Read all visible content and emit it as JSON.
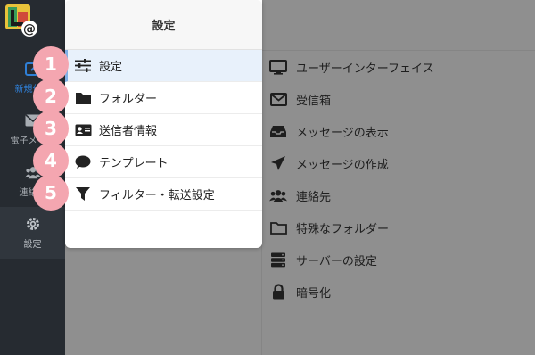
{
  "rail": {
    "items": [
      {
        "label": "新規作成",
        "icon": "compose-icon"
      },
      {
        "label": "電子メール",
        "icon": "envelope-icon"
      },
      {
        "label": "連絡先",
        "icon": "contacts-icon"
      },
      {
        "label": "設定",
        "icon": "gear-icon"
      }
    ]
  },
  "panel": {
    "title": "設定",
    "items": [
      {
        "label": "設定",
        "icon": "sliders-icon",
        "active": true
      },
      {
        "label": "フォルダー",
        "icon": "folder-icon"
      },
      {
        "label": "送信者情報",
        "icon": "id-card-icon"
      },
      {
        "label": "テンプレート",
        "icon": "speech-bubble-icon"
      },
      {
        "label": "フィルター・転送設定",
        "icon": "filter-icon"
      }
    ]
  },
  "badges": [
    "1",
    "2",
    "3",
    "4",
    "5"
  ],
  "sublist": {
    "items": [
      {
        "label": "ユーザーインターフェイス",
        "icon": "monitor-icon"
      },
      {
        "label": "受信箱",
        "icon": "envelope-icon"
      },
      {
        "label": "メッセージの表示",
        "icon": "inbox-tray-icon"
      },
      {
        "label": "メッセージの作成",
        "icon": "paper-plane-icon"
      },
      {
        "label": "連絡先",
        "icon": "users-icon"
      },
      {
        "label": "特殊なフォルダー",
        "icon": "folder-outline-icon"
      },
      {
        "label": "サーバーの設定",
        "icon": "server-icon"
      },
      {
        "label": "暗号化",
        "icon": "lock-icon"
      }
    ]
  },
  "colors": {
    "rail_bg": "#262b31",
    "overlay": "#8f8f8f",
    "badge": "#f4a6b0",
    "active_bg": "#e8f1fb",
    "accent": "#2f7fd6"
  }
}
